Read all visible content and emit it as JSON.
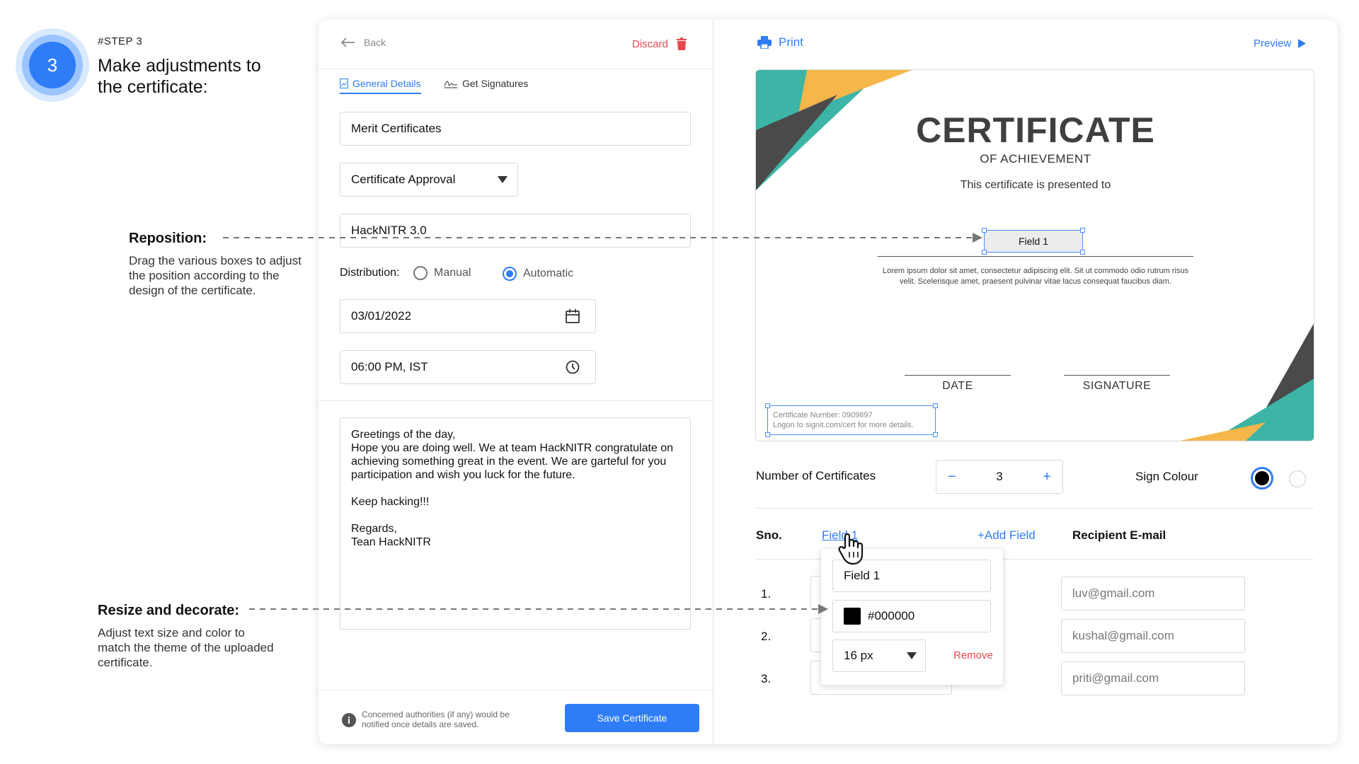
{
  "step": {
    "number": "3",
    "tag": "#STEP 3",
    "title": "Make adjustments to the certificate:"
  },
  "annotations": {
    "reposition": {
      "title": "Reposition:",
      "text": "Drag the various boxes to adjust the position according to the design of the certificate."
    },
    "resize": {
      "title": "Resize and decorate:",
      "text": "Adjust text size and color to match the theme of the uploaded certificate."
    }
  },
  "left_panel": {
    "back_label": "Back",
    "discard_label": "Discard",
    "tabs": [
      {
        "label": "General Details",
        "icon": "image-icon",
        "active": true
      },
      {
        "label": "Get Signatures",
        "icon": "signature-icon",
        "active": false
      }
    ],
    "certificate_name": "Merit Certificates",
    "template_select": "Certificate Approval",
    "event_name": "HackNITR 3.0",
    "distribution": {
      "label": "Distribution:",
      "options": [
        "Manual",
        "Automatic"
      ],
      "selected": "Automatic"
    },
    "date": "03/01/2022",
    "time": "06:00 PM, IST",
    "message": "Greetings of the day,\nHope you are doing well. We at team HackNITR congratulate on achieving something great in the event. We are garteful for you participation and wish you luck for the future.\n\nKeep hacking!!!\n\nRegards,\nTean HackNITR",
    "footer_note": "Concerned authorities (if any) would be notified once details are saved.",
    "save_label": "Save Certificate"
  },
  "right_panel": {
    "print_label": "Print",
    "preview_label": "Preview",
    "certificate": {
      "title": "CERTIFICATE",
      "subtitle": "OF ACHIEVEMENT",
      "presented": "This certificate is presented to",
      "field_label": "Field 1",
      "lorem": "Lorem ipsum dolor sit amet, consectetur adipiscing elit. Sit ut commodo odio rutrum risus velit. Scelerisque amet, praesent pulvinar vitae lacus consequat faucibus diam.",
      "date_label": "DATE",
      "signature_label": "SIGNATURE",
      "cert_number": "Certificate Number: 0909897",
      "cert_logon": "Logon to signit.com/cert for more details.",
      "colors": {
        "teal": "#3cb4a6",
        "dark": "#4a4a4a",
        "yellow": "#f5b64a"
      }
    },
    "num_certificates_label": "Number of Certificates",
    "num_certificates_value": "3",
    "stepper_minus": "−",
    "stepper_plus": "+",
    "sign_colour_label": "Sign Colour",
    "sign_colours": [
      "#000000",
      "#ffffff"
    ],
    "table": {
      "sno_header": "Sno.",
      "field_header": "Field 1",
      "add_field": "+Add Field",
      "email_header": "Recipient E-mail",
      "rows": [
        {
          "sno": "1.",
          "email": "luv@gmail.com"
        },
        {
          "sno": "2.",
          "email": "kushal@gmail.com"
        },
        {
          "sno": "3.",
          "email": "priti@gmail.com"
        }
      ]
    },
    "popover": {
      "field_name": "Field 1",
      "color": "#000000",
      "size": "16 px",
      "remove_label": "Remove"
    }
  }
}
